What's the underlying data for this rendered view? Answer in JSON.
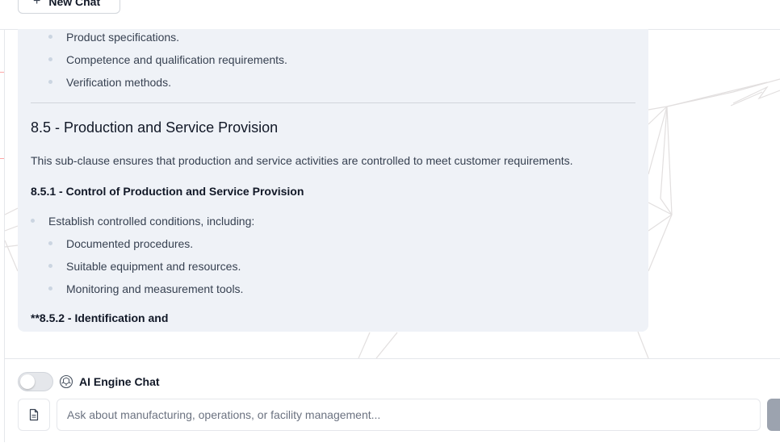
{
  "header": {
    "new_chat_label": "New Chat",
    "new_chat_icon": "plus-icon"
  },
  "message": {
    "list_top": [
      "Product specifications.",
      "Competence and qualification requirements.",
      "Verification methods."
    ],
    "section_heading": "8.5 - Production and Service Provision",
    "section_intro": "This sub-clause ensures that production and service activities are controlled to meet customer requirements.",
    "subsection_heading": "8.5.1 - Control of Production and Service Provision",
    "list_main": "Establish controlled conditions, including:",
    "list_sub": [
      "Documented procedures.",
      "Suitable equipment and resources.",
      "Monitoring and measurement tools."
    ],
    "next_heading_partial": "**8.5.2 - Identification and"
  },
  "composer": {
    "toggle_on": false,
    "engine_icon": "ai-engine-icon",
    "engine_label": "AI Engine Chat",
    "attach_icon": "file-icon",
    "input_placeholder": "Ask about manufacturing, operations, or facility management...",
    "input_value": ""
  },
  "colors": {
    "card_bg": "#eff2f7",
    "border": "#e5e7eb",
    "text": "#374151",
    "heading": "#111827",
    "send_button": "#9ca3af"
  }
}
